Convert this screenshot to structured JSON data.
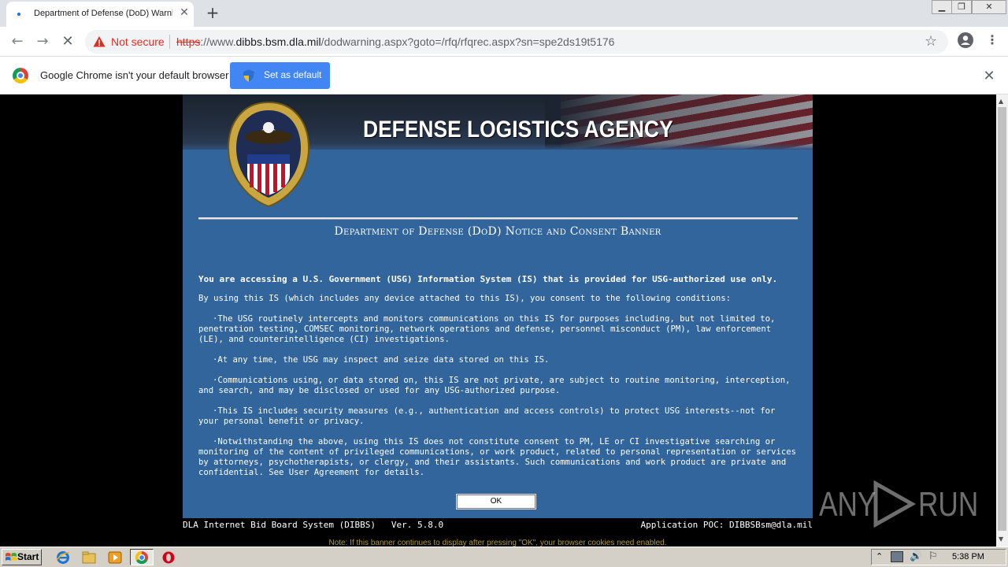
{
  "browser": {
    "tab": {
      "title": "Department of Defense (DoD) Warning"
    },
    "new_tab_label": "+",
    "window_buttons": {
      "minimize": "▁",
      "restore": "❐",
      "close": "✕"
    },
    "nav": {
      "back": "←",
      "forward": "→",
      "stop": "✕"
    },
    "omnibox": {
      "security_label": "Not secure",
      "scheme": "https",
      "host_prefix": "://www.",
      "host": "dibbs.bsm.dla.mil",
      "path": "/dodwarning.aspx?goto=/rfq/rfqrec.aspx?sn=spe2ds19t5176"
    },
    "bookmark_star": "☆",
    "menu": "⋮"
  },
  "infobar": {
    "message": "Google Chrome isn't your default browser",
    "button_label": "Set as default",
    "close": "✕"
  },
  "page": {
    "agency_title": "DEFENSE LOGISTICS AGENCY",
    "notice_title": "Department of Defense (DoD) Notice and Consent Banner",
    "lead": "You are accessing a U.S. Government (USG) Information System (IS) that is provided for USG-authorized use only.",
    "intro": "By using this IS (which includes any device attached to this IS), you consent to the following conditions:",
    "conditions": [
      "·The USG routinely intercepts and monitors communications on this IS for purposes including, but not limited to, penetration testing, COMSEC monitoring, network operations and defense, personnel misconduct (PM), law enforcement (LE), and counterintelligence (CI) investigations.",
      "·At any time, the USG may inspect and seize data stored on this IS.",
      "·Communications using, or data stored on, this IS are not private, are subject to routine monitoring, interception, and search, and may be disclosed or used for any USG-authorized purpose.",
      "·This IS includes security measures (e.g., authentication and access controls) to protect USG interests--not for your personal benefit or privacy.",
      "·Notwithstanding the above, using this IS does not constitute consent to PM, LE or CI investigative searching or monitoring of the content of privileged communications, or work product, related to personal representation or services by attorneys, psychotherapists, or clergy, and their assistants.  Such communications and work product are private and confidential.  See User Agreement for details."
    ],
    "ok_label": "OK",
    "footer_left": "DLA Internet Bid Board System (DIBBS)   Ver. 5.8.0",
    "footer_right": "Application POC: DIBBSBsm@dla.mil",
    "cookie_note": "Note: If this banner continues to display after pressing \"OK\", your browser cookies need enabled."
  },
  "watermark": {
    "left": "ANY",
    "right": "RUN"
  },
  "taskbar": {
    "start_label": "Start",
    "clock": "5:38 PM"
  },
  "colors": {
    "panel_blue": "#31659c",
    "banner_dark": "#1b2430",
    "chrome_blue": "#4285f4",
    "not_secure_red": "#d93025"
  }
}
